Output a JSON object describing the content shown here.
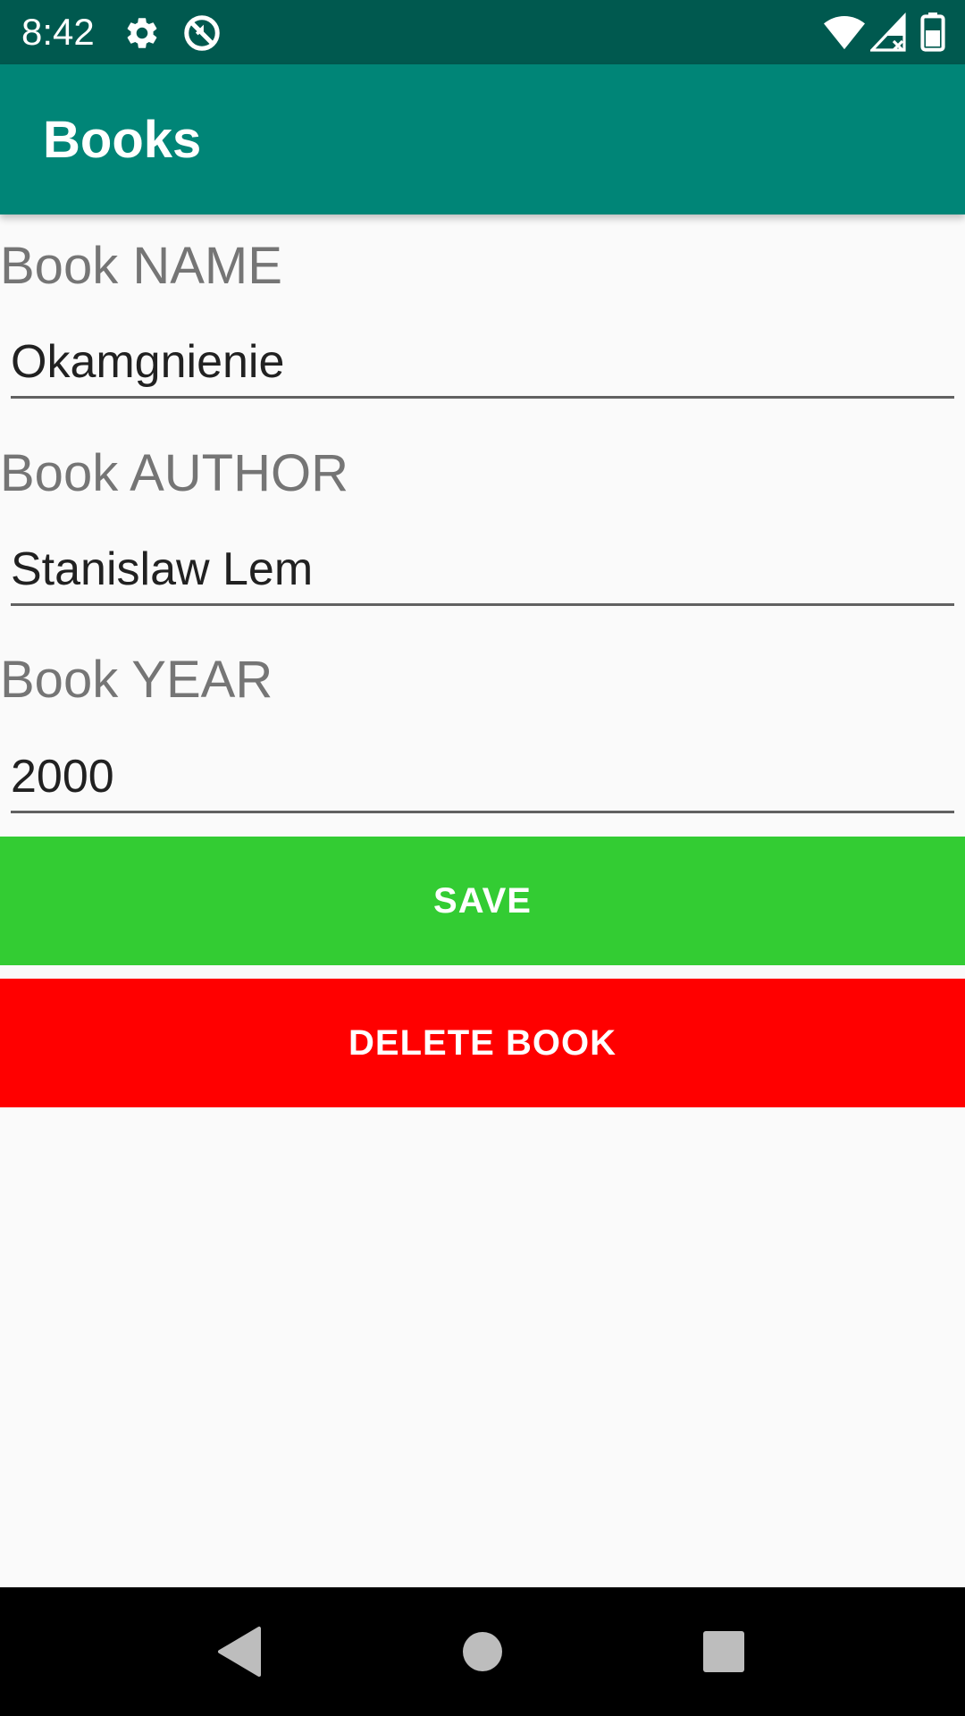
{
  "status_bar": {
    "time": "8:42",
    "left_icons": [
      "gear-icon",
      "sync-off-icon"
    ],
    "right_icons": [
      "wifi-icon",
      "cell-signal-icon",
      "battery-icon"
    ]
  },
  "app_bar": {
    "title": "Books"
  },
  "form": {
    "name": {
      "label": "Book NAME",
      "value": "Okamgnienie"
    },
    "author": {
      "label": "Book AUTHOR",
      "value": "Stanislaw Lem"
    },
    "year": {
      "label": "Book YEAR",
      "value": "2000"
    }
  },
  "buttons": {
    "save": "SAVE",
    "delete": "DELETE BOOK"
  },
  "nav_bar": {
    "icons": [
      "back-icon",
      "home-icon",
      "recents-icon"
    ]
  },
  "colors": {
    "status_bar": "#00594f",
    "app_bar": "#008577",
    "save_button": "#33cc33",
    "delete_button": "#ff0000",
    "background": "#fafafa"
  }
}
